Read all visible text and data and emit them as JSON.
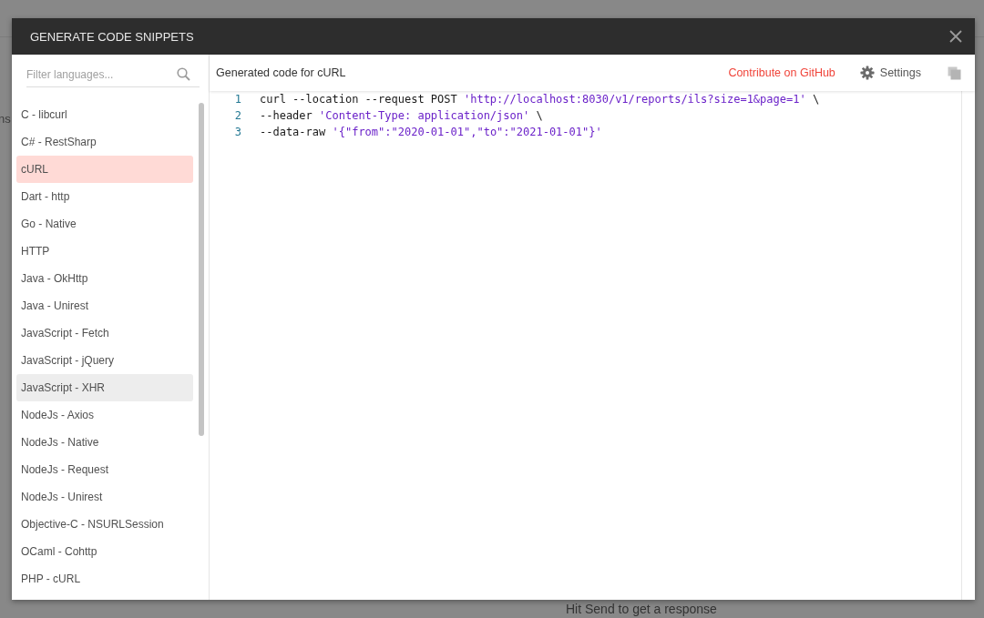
{
  "background": {
    "side_fragment": "ns",
    "response_hint": "Hit Send to get a response"
  },
  "modal": {
    "title": "GENERATE CODE SNIPPETS",
    "filter": {
      "placeholder": "Filter languages..."
    },
    "languages": [
      {
        "label": "C - libcurl",
        "selected": false,
        "hovered": false
      },
      {
        "label": "C# - RestSharp",
        "selected": false,
        "hovered": false
      },
      {
        "label": "cURL",
        "selected": true,
        "hovered": false
      },
      {
        "label": "Dart - http",
        "selected": false,
        "hovered": false
      },
      {
        "label": "Go - Native",
        "selected": false,
        "hovered": false
      },
      {
        "label": "HTTP",
        "selected": false,
        "hovered": false
      },
      {
        "label": "Java - OkHttp",
        "selected": false,
        "hovered": false
      },
      {
        "label": "Java - Unirest",
        "selected": false,
        "hovered": false
      },
      {
        "label": "JavaScript - Fetch",
        "selected": false,
        "hovered": false
      },
      {
        "label": "JavaScript - jQuery",
        "selected": false,
        "hovered": false
      },
      {
        "label": "JavaScript - XHR",
        "selected": false,
        "hovered": true
      },
      {
        "label": "NodeJs - Axios",
        "selected": false,
        "hovered": false
      },
      {
        "label": "NodeJs - Native",
        "selected": false,
        "hovered": false
      },
      {
        "label": "NodeJs - Request",
        "selected": false,
        "hovered": false
      },
      {
        "label": "NodeJs - Unirest",
        "selected": false,
        "hovered": false
      },
      {
        "label": "Objective-C - NSURLSession",
        "selected": false,
        "hovered": false
      },
      {
        "label": "OCaml - Cohttp",
        "selected": false,
        "hovered": false
      },
      {
        "label": "PHP - cURL",
        "selected": false,
        "hovered": false
      }
    ],
    "code_header": "Generated code for cURL",
    "contribute_link": "Contribute on GitHub",
    "settings_button": "Settings",
    "code_lines": [
      {
        "number": "1",
        "tokens": [
          {
            "kind": "plain",
            "text": "curl --location --request POST "
          },
          {
            "kind": "string",
            "text": "'http://localhost:8030/v1/reports/ils?size=1&page=1'"
          },
          {
            "kind": "plain",
            "text": " \\"
          }
        ]
      },
      {
        "number": "2",
        "tokens": [
          {
            "kind": "plain",
            "text": "--header "
          },
          {
            "kind": "string",
            "text": "'Content-Type: application/json'"
          },
          {
            "kind": "plain",
            "text": " \\"
          }
        ]
      },
      {
        "number": "3",
        "tokens": [
          {
            "kind": "plain",
            "text": "--data-raw "
          },
          {
            "kind": "string",
            "text": "'{\"from\":\"2020-01-01\",\"to\":\"2021-01-01\"}'"
          }
        ]
      }
    ]
  }
}
